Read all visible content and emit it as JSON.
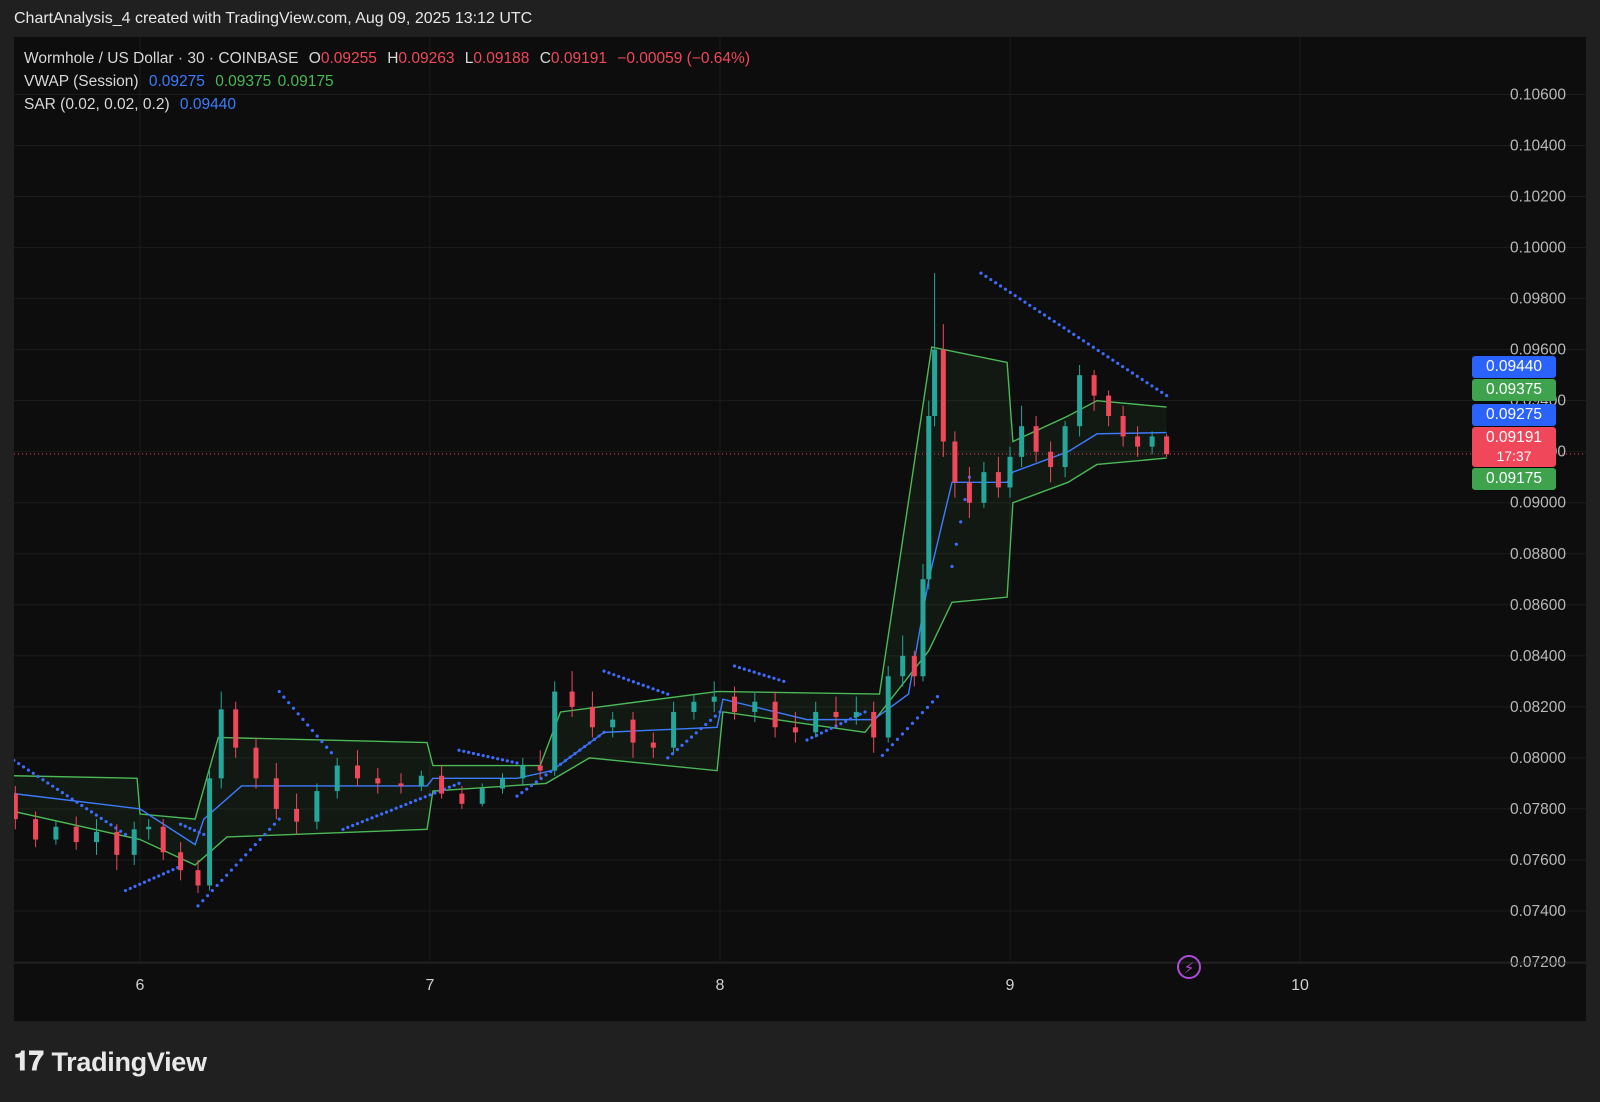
{
  "header": {
    "attribution": "ChartAnalysis_4 created with TradingView.com, Aug 09, 2025 13:12 UTC"
  },
  "legend": {
    "symbol": "Wormhole / US Dollar · 30 · COINBASE",
    "o_label": "O",
    "o_value": "0.09255",
    "h_label": "H",
    "h_value": "0.09263",
    "l_label": "L",
    "l_value": "0.09188",
    "c_label": "C",
    "c_value": "0.09191",
    "change": "−0.00059 (−0.64%)",
    "vwap_label": "VWAP (Session)",
    "vwap_values": [
      "0.09275",
      "0.09375",
      "0.09175"
    ],
    "sar_label": "SAR (0.02, 0.02, 0.2)",
    "sar_value": "0.09440"
  },
  "badges": {
    "sar": "0.09440",
    "vwap_upper": "0.09375",
    "vwap": "0.09275",
    "last_price": "0.09191",
    "countdown": "17:37",
    "vwap_lower": "0.09175"
  },
  "colors": {
    "up": "#26a69a",
    "down": "#f0485a",
    "vwap": "#3d7cff",
    "band": "#4cb857",
    "sar": "#3d6cff",
    "grid": "#1c1c1c",
    "background": "#0d0d0d"
  },
  "footer": {
    "brand": "TradingView",
    "brand_icon": "tradingview-logo-icon",
    "flash_icon": "lightning-icon"
  },
  "chart_data": {
    "type": "candlestick",
    "timeframe": "30",
    "ylim": [
      0.072,
      0.107
    ],
    "y_ticks": [
      "0.10600",
      "0.10400",
      "0.10200",
      "0.10000",
      "0.09800",
      "0.09600",
      "0.09400",
      "0.09200",
      "0.09000",
      "0.08800",
      "0.08600",
      "0.08400",
      "0.08200",
      "0.08000",
      "0.07800",
      "0.07600",
      "0.07400",
      "0.07200"
    ],
    "x_ticks": [
      {
        "label": "6",
        "day": 6
      },
      {
        "label": "7",
        "day": 7
      },
      {
        "label": "8",
        "day": 8
      },
      {
        "label": "9",
        "day": 9
      },
      {
        "label": "10",
        "day": 10
      }
    ],
    "xlim": [
      5.565,
      11.0
    ],
    "last_price": 0.09191,
    "candles": [
      {
        "t": 5.57,
        "o": 0.0786,
        "h": 0.0789,
        "l": 0.0772,
        "c": 0.0776
      },
      {
        "t": 5.64,
        "o": 0.0776,
        "h": 0.0779,
        "l": 0.0765,
        "c": 0.0768
      },
      {
        "t": 5.71,
        "o": 0.0768,
        "h": 0.0775,
        "l": 0.0766,
        "c": 0.0773
      },
      {
        "t": 5.78,
        "o": 0.0773,
        "h": 0.0777,
        "l": 0.0764,
        "c": 0.0767
      },
      {
        "t": 5.85,
        "o": 0.0767,
        "h": 0.0776,
        "l": 0.0762,
        "c": 0.0771
      },
      {
        "t": 5.92,
        "o": 0.0771,
        "h": 0.0774,
        "l": 0.0756,
        "c": 0.0762
      },
      {
        "t": 5.98,
        "o": 0.0762,
        "h": 0.0775,
        "l": 0.0758,
        "c": 0.0772
      },
      {
        "t": 6.03,
        "o": 0.0772,
        "h": 0.0776,
        "l": 0.0768,
        "c": 0.0773
      },
      {
        "t": 6.08,
        "o": 0.0773,
        "h": 0.0776,
        "l": 0.076,
        "c": 0.0763
      },
      {
        "t": 6.14,
        "o": 0.0763,
        "h": 0.0767,
        "l": 0.0752,
        "c": 0.0756
      },
      {
        "t": 6.2,
        "o": 0.0756,
        "h": 0.076,
        "l": 0.0747,
        "c": 0.075
      },
      {
        "t": 6.24,
        "o": 0.075,
        "h": 0.0795,
        "l": 0.0748,
        "c": 0.0792
      },
      {
        "t": 6.28,
        "o": 0.0792,
        "h": 0.0826,
        "l": 0.0788,
        "c": 0.0819
      },
      {
        "t": 6.33,
        "o": 0.0819,
        "h": 0.0822,
        "l": 0.08,
        "c": 0.0804
      },
      {
        "t": 6.4,
        "o": 0.0804,
        "h": 0.0808,
        "l": 0.0788,
        "c": 0.0792
      },
      {
        "t": 6.47,
        "o": 0.0792,
        "h": 0.0798,
        "l": 0.0776,
        "c": 0.078
      },
      {
        "t": 6.54,
        "o": 0.078,
        "h": 0.0786,
        "l": 0.077,
        "c": 0.0775
      },
      {
        "t": 6.61,
        "o": 0.0775,
        "h": 0.079,
        "l": 0.0772,
        "c": 0.0787
      },
      {
        "t": 6.68,
        "o": 0.0787,
        "h": 0.08,
        "l": 0.0784,
        "c": 0.0797
      },
      {
        "t": 6.75,
        "o": 0.0797,
        "h": 0.0803,
        "l": 0.0789,
        "c": 0.0792
      },
      {
        "t": 6.82,
        "o": 0.0792,
        "h": 0.0796,
        "l": 0.0786,
        "c": 0.079
      },
      {
        "t": 6.9,
        "o": 0.079,
        "h": 0.0794,
        "l": 0.0786,
        "c": 0.0789
      },
      {
        "t": 6.97,
        "o": 0.0789,
        "h": 0.0795,
        "l": 0.0787,
        "c": 0.0793
      },
      {
        "t": 7.04,
        "o": 0.0793,
        "h": 0.0797,
        "l": 0.0784,
        "c": 0.0786
      },
      {
        "t": 7.11,
        "o": 0.0786,
        "h": 0.0789,
        "l": 0.078,
        "c": 0.0782
      },
      {
        "t": 7.18,
        "o": 0.0782,
        "h": 0.079,
        "l": 0.0781,
        "c": 0.0788
      },
      {
        "t": 7.25,
        "o": 0.0788,
        "h": 0.0794,
        "l": 0.0786,
        "c": 0.0792
      },
      {
        "t": 7.32,
        "o": 0.0792,
        "h": 0.08,
        "l": 0.0789,
        "c": 0.0797
      },
      {
        "t": 7.38,
        "o": 0.0797,
        "h": 0.0803,
        "l": 0.0792,
        "c": 0.0795
      },
      {
        "t": 7.43,
        "o": 0.0795,
        "h": 0.083,
        "l": 0.0793,
        "c": 0.0826
      },
      {
        "t": 7.49,
        "o": 0.0826,
        "h": 0.0834,
        "l": 0.0816,
        "c": 0.082
      },
      {
        "t": 7.56,
        "o": 0.082,
        "h": 0.0826,
        "l": 0.0808,
        "c": 0.0812
      },
      {
        "t": 7.63,
        "o": 0.0812,
        "h": 0.0818,
        "l": 0.0808,
        "c": 0.0815
      },
      {
        "t": 7.7,
        "o": 0.0815,
        "h": 0.0818,
        "l": 0.08,
        "c": 0.0806
      },
      {
        "t": 7.77,
        "o": 0.0806,
        "h": 0.081,
        "l": 0.08,
        "c": 0.0804
      },
      {
        "t": 7.84,
        "o": 0.0804,
        "h": 0.0822,
        "l": 0.0802,
        "c": 0.0818
      },
      {
        "t": 7.91,
        "o": 0.0818,
        "h": 0.0825,
        "l": 0.0815,
        "c": 0.0822
      },
      {
        "t": 7.98,
        "o": 0.0822,
        "h": 0.083,
        "l": 0.0818,
        "c": 0.0824
      },
      {
        "t": 8.05,
        "o": 0.0824,
        "h": 0.0828,
        "l": 0.0815,
        "c": 0.0818
      },
      {
        "t": 8.12,
        "o": 0.0818,
        "h": 0.0826,
        "l": 0.0814,
        "c": 0.0822
      },
      {
        "t": 8.19,
        "o": 0.0822,
        "h": 0.0826,
        "l": 0.0808,
        "c": 0.0812
      },
      {
        "t": 8.26,
        "o": 0.0812,
        "h": 0.0818,
        "l": 0.0806,
        "c": 0.081
      },
      {
        "t": 8.33,
        "o": 0.081,
        "h": 0.0822,
        "l": 0.0808,
        "c": 0.0818
      },
      {
        "t": 8.4,
        "o": 0.0818,
        "h": 0.0824,
        "l": 0.0812,
        "c": 0.0816
      },
      {
        "t": 8.47,
        "o": 0.0816,
        "h": 0.0824,
        "l": 0.0813,
        "c": 0.0818
      },
      {
        "t": 8.53,
        "o": 0.0818,
        "h": 0.0822,
        "l": 0.0802,
        "c": 0.0808
      },
      {
        "t": 8.58,
        "o": 0.0808,
        "h": 0.0836,
        "l": 0.0806,
        "c": 0.0832
      },
      {
        "t": 8.63,
        "o": 0.0832,
        "h": 0.0848,
        "l": 0.0828,
        "c": 0.084
      },
      {
        "t": 8.67,
        "o": 0.084,
        "h": 0.0842,
        "l": 0.0828,
        "c": 0.0832
      },
      {
        "t": 8.7,
        "o": 0.0832,
        "h": 0.0876,
        "l": 0.083,
        "c": 0.087
      },
      {
        "t": 8.72,
        "o": 0.087,
        "h": 0.094,
        "l": 0.0866,
        "c": 0.0934
      },
      {
        "t": 8.74,
        "o": 0.0934,
        "h": 0.099,
        "l": 0.093,
        "c": 0.096
      },
      {
        "t": 8.77,
        "o": 0.096,
        "h": 0.097,
        "l": 0.0918,
        "c": 0.0924
      },
      {
        "t": 8.81,
        "o": 0.0924,
        "h": 0.0928,
        "l": 0.0902,
        "c": 0.0908
      },
      {
        "t": 8.86,
        "o": 0.0908,
        "h": 0.0914,
        "l": 0.0894,
        "c": 0.09
      },
      {
        "t": 8.91,
        "o": 0.09,
        "h": 0.0916,
        "l": 0.0898,
        "c": 0.0912
      },
      {
        "t": 8.96,
        "o": 0.0912,
        "h": 0.0918,
        "l": 0.0902,
        "c": 0.0906
      },
      {
        "t": 9.0,
        "o": 0.0906,
        "h": 0.0922,
        "l": 0.0902,
        "c": 0.0918
      },
      {
        "t": 9.04,
        "o": 0.0918,
        "h": 0.0938,
        "l": 0.0914,
        "c": 0.093
      },
      {
        "t": 9.09,
        "o": 0.093,
        "h": 0.0934,
        "l": 0.0916,
        "c": 0.092
      },
      {
        "t": 9.14,
        "o": 0.092,
        "h": 0.0924,
        "l": 0.0908,
        "c": 0.0914
      },
      {
        "t": 9.19,
        "o": 0.0914,
        "h": 0.0932,
        "l": 0.091,
        "c": 0.093
      },
      {
        "t": 9.24,
        "o": 0.093,
        "h": 0.0954,
        "l": 0.0926,
        "c": 0.095
      },
      {
        "t": 9.29,
        "o": 0.095,
        "h": 0.0952,
        "l": 0.0936,
        "c": 0.0942
      },
      {
        "t": 9.34,
        "o": 0.0942,
        "h": 0.0944,
        "l": 0.093,
        "c": 0.0934
      },
      {
        "t": 9.39,
        "o": 0.0934,
        "h": 0.0938,
        "l": 0.0922,
        "c": 0.0926
      },
      {
        "t": 9.44,
        "o": 0.0926,
        "h": 0.093,
        "l": 0.0918,
        "c": 0.0922
      },
      {
        "t": 9.49,
        "o": 0.0922,
        "h": 0.0928,
        "l": 0.0919,
        "c": 0.0926
      },
      {
        "t": 9.54,
        "o": 0.0926,
        "h": 0.0927,
        "l": 0.0918,
        "c": 0.0919
      }
    ],
    "vwap": [
      {
        "t": 5.565,
        "v": 0.0786
      },
      {
        "t": 6.0,
        "v": 0.078
      },
      {
        "t": 6.19,
        "v": 0.0766
      },
      {
        "t": 6.22,
        "v": 0.0776
      },
      {
        "t": 6.35,
        "v": 0.0789
      },
      {
        "t": 6.7,
        "v": 0.0789
      },
      {
        "t": 6.99,
        "v": 0.0789
      },
      {
        "t": 7.01,
        "v": 0.0792
      },
      {
        "t": 7.3,
        "v": 0.0792
      },
      {
        "t": 7.42,
        "v": 0.0795
      },
      {
        "t": 7.6,
        "v": 0.081
      },
      {
        "t": 7.99,
        "v": 0.0812
      },
      {
        "t": 8.01,
        "v": 0.0823
      },
      {
        "t": 8.3,
        "v": 0.0815
      },
      {
        "t": 8.53,
        "v": 0.0815
      },
      {
        "t": 8.65,
        "v": 0.0825
      },
      {
        "t": 8.72,
        "v": 0.087
      },
      {
        "t": 8.8,
        "v": 0.0908
      },
      {
        "t": 8.99,
        "v": 0.0908
      },
      {
        "t": 9.01,
        "v": 0.0912
      },
      {
        "t": 9.2,
        "v": 0.092
      },
      {
        "t": 9.3,
        "v": 0.0927
      },
      {
        "t": 9.54,
        "v": 0.09275
      }
    ],
    "vwap_upper": [
      {
        "t": 5.565,
        "v": 0.0793
      },
      {
        "t": 5.99,
        "v": 0.0792
      },
      {
        "t": 6.0,
        "v": 0.0778
      },
      {
        "t": 6.19,
        "v": 0.0776
      },
      {
        "t": 6.27,
        "v": 0.0808
      },
      {
        "t": 6.99,
        "v": 0.0806
      },
      {
        "t": 7.01,
        "v": 0.0797
      },
      {
        "t": 7.38,
        "v": 0.0797
      },
      {
        "t": 7.45,
        "v": 0.0818
      },
      {
        "t": 7.99,
        "v": 0.0826
      },
      {
        "t": 8.01,
        "v": 0.0826
      },
      {
        "t": 8.55,
        "v": 0.0825
      },
      {
        "t": 8.73,
        "v": 0.0961
      },
      {
        "t": 8.99,
        "v": 0.0955
      },
      {
        "t": 9.01,
        "v": 0.0924
      },
      {
        "t": 9.2,
        "v": 0.0934
      },
      {
        "t": 9.3,
        "v": 0.094
      },
      {
        "t": 9.54,
        "v": 0.09375
      }
    ],
    "vwap_lower": [
      {
        "t": 5.565,
        "v": 0.0779
      },
      {
        "t": 6.0,
        "v": 0.0768
      },
      {
        "t": 6.19,
        "v": 0.0758
      },
      {
        "t": 6.3,
        "v": 0.0769
      },
      {
        "t": 6.99,
        "v": 0.0772
      },
      {
        "t": 7.01,
        "v": 0.0787
      },
      {
        "t": 7.4,
        "v": 0.079
      },
      {
        "t": 7.55,
        "v": 0.08
      },
      {
        "t": 7.99,
        "v": 0.0795
      },
      {
        "t": 8.01,
        "v": 0.0818
      },
      {
        "t": 8.5,
        "v": 0.081
      },
      {
        "t": 8.72,
        "v": 0.0842
      },
      {
        "t": 8.8,
        "v": 0.0861
      },
      {
        "t": 8.99,
        "v": 0.0863
      },
      {
        "t": 9.01,
        "v": 0.09
      },
      {
        "t": 9.2,
        "v": 0.0908
      },
      {
        "t": 9.3,
        "v": 0.0915
      },
      {
        "t": 9.54,
        "v": 0.09175
      }
    ],
    "sar_segments": [
      {
        "t0": 5.565,
        "v0": 0.0799,
        "t1": 5.95,
        "v1": 0.077
      },
      {
        "t0": 5.95,
        "v0": 0.0748,
        "t1": 6.13,
        "v1": 0.0757
      },
      {
        "t0": 6.14,
        "v0": 0.0774,
        "t1": 6.22,
        "v1": 0.077
      },
      {
        "t0": 6.2,
        "v0": 0.0742,
        "t1": 6.48,
        "v1": 0.0776
      },
      {
        "t0": 6.48,
        "v0": 0.0826,
        "t1": 6.66,
        "v1": 0.0802
      },
      {
        "t0": 6.7,
        "v0": 0.0772,
        "t1": 7.1,
        "v1": 0.079
      },
      {
        "t0": 7.1,
        "v0": 0.0803,
        "t1": 7.3,
        "v1": 0.0798
      },
      {
        "t0": 7.3,
        "v0": 0.0785,
        "t1": 7.6,
        "v1": 0.081
      },
      {
        "t0": 7.6,
        "v0": 0.0834,
        "t1": 7.82,
        "v1": 0.0825
      },
      {
        "t0": 7.82,
        "v0": 0.08,
        "t1": 8.0,
        "v1": 0.0818
      },
      {
        "t0": 8.05,
        "v0": 0.0836,
        "t1": 8.22,
        "v1": 0.083
      },
      {
        "t0": 8.3,
        "v0": 0.0807,
        "t1": 8.5,
        "v1": 0.0818
      },
      {
        "t0": 8.56,
        "v0": 0.0801,
        "t1": 8.75,
        "v1": 0.0824
      },
      {
        "t0": 8.8,
        "v0": 0.0875,
        "t1": 8.86,
        "v1": 0.091
      },
      {
        "t0": 8.9,
        "v0": 0.099,
        "t1": 9.54,
        "v1": 0.0942
      }
    ]
  }
}
